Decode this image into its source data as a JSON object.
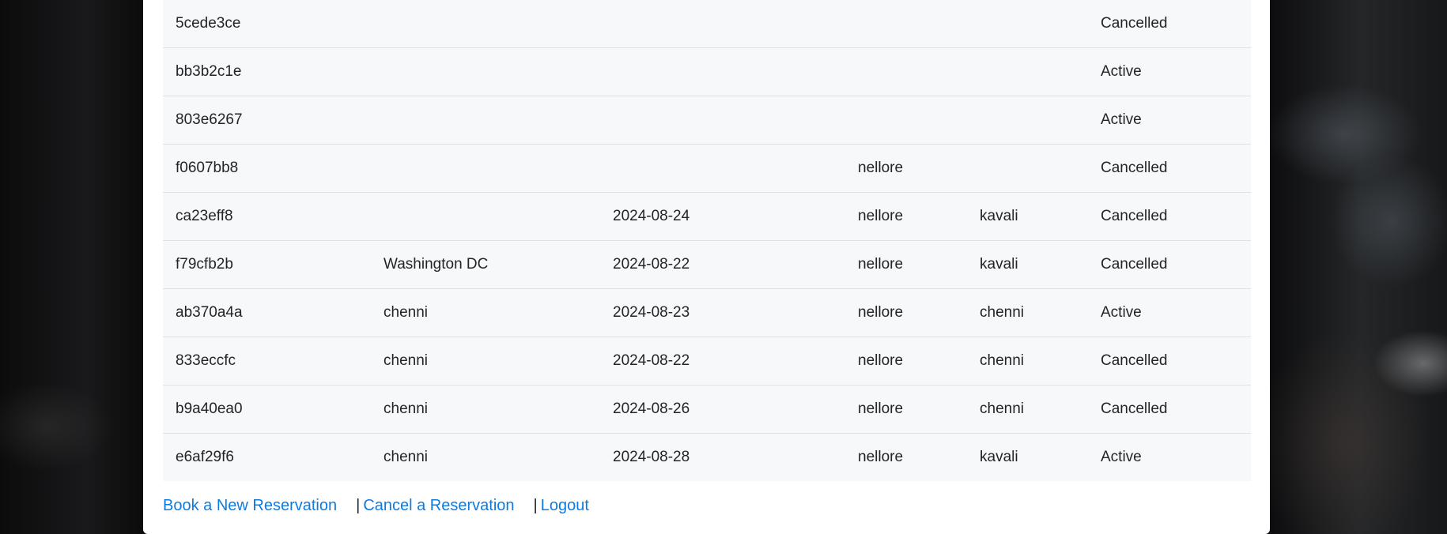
{
  "reservations": [
    {
      "id": "5cede3ce",
      "origin": "",
      "date": "",
      "from": "",
      "to": "",
      "status": "Cancelled"
    },
    {
      "id": "bb3b2c1e",
      "origin": "",
      "date": "",
      "from": "",
      "to": "",
      "status": "Active"
    },
    {
      "id": "803e6267",
      "origin": "",
      "date": "",
      "from": "",
      "to": "",
      "status": "Active"
    },
    {
      "id": "f0607bb8",
      "origin": "",
      "date": "",
      "from": "nellore",
      "to": "",
      "status": "Cancelled"
    },
    {
      "id": "ca23eff8",
      "origin": "",
      "date": "2024-08-24",
      "from": "nellore",
      "to": "kavali",
      "status": "Cancelled"
    },
    {
      "id": "f79cfb2b",
      "origin": "Washington DC",
      "date": "2024-08-22",
      "from": "nellore",
      "to": "kavali",
      "status": "Cancelled"
    },
    {
      "id": "ab370a4a",
      "origin": "chenni",
      "date": "2024-08-23",
      "from": "nellore",
      "to": "chenni",
      "status": "Active"
    },
    {
      "id": "833eccfc",
      "origin": "chenni",
      "date": "2024-08-22",
      "from": "nellore",
      "to": "chenni",
      "status": "Cancelled"
    },
    {
      "id": "b9a40ea0",
      "origin": "chenni",
      "date": "2024-08-26",
      "from": "nellore",
      "to": "chenni",
      "status": "Cancelled"
    },
    {
      "id": "e6af29f6",
      "origin": "chenni",
      "date": "2024-08-28",
      "from": "nellore",
      "to": "kavali",
      "status": "Active"
    }
  ],
  "footer": {
    "book_label": "Book a New Reservation",
    "separator": "|",
    "cancel_label": "Cancel a Reservation",
    "logout_label": "Logout"
  }
}
